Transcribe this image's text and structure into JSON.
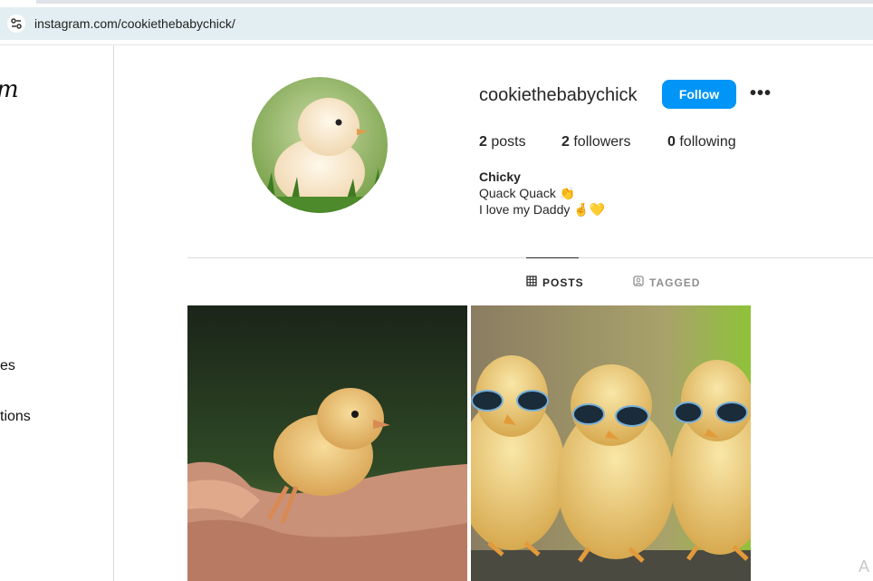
{
  "browser": {
    "url": "instagram.com/cookiethebabychick/",
    "site_info_icon": "tune-icon"
  },
  "sidebar": {
    "logo_fragment": "m",
    "items": [
      {
        "label": "es"
      },
      {
        "label": "tions"
      }
    ]
  },
  "profile": {
    "username": "cookiethebabychick",
    "follow_label": "Follow",
    "more_label": "•••",
    "stats": {
      "posts_count": "2",
      "posts_label": "posts",
      "followers_count": "2",
      "followers_label": "followers",
      "following_count": "0",
      "following_label": "following"
    },
    "bio": {
      "name": "Chicky",
      "line1": "Quack Quack 👏",
      "line2": "I love my Daddy 🤞💛"
    }
  },
  "tabs": [
    {
      "label": "POSTS",
      "icon": "grid-icon",
      "active": true
    },
    {
      "label": "TAGGED",
      "icon": "tag-person-icon",
      "active": false
    }
  ],
  "posts": [
    {
      "description": "chick-in-hand"
    },
    {
      "description": "chicks-with-sunglasses"
    }
  ],
  "corner_fragment": "A",
  "colors": {
    "accent": "#0095f6",
    "url_bar": "#e3eef2"
  }
}
